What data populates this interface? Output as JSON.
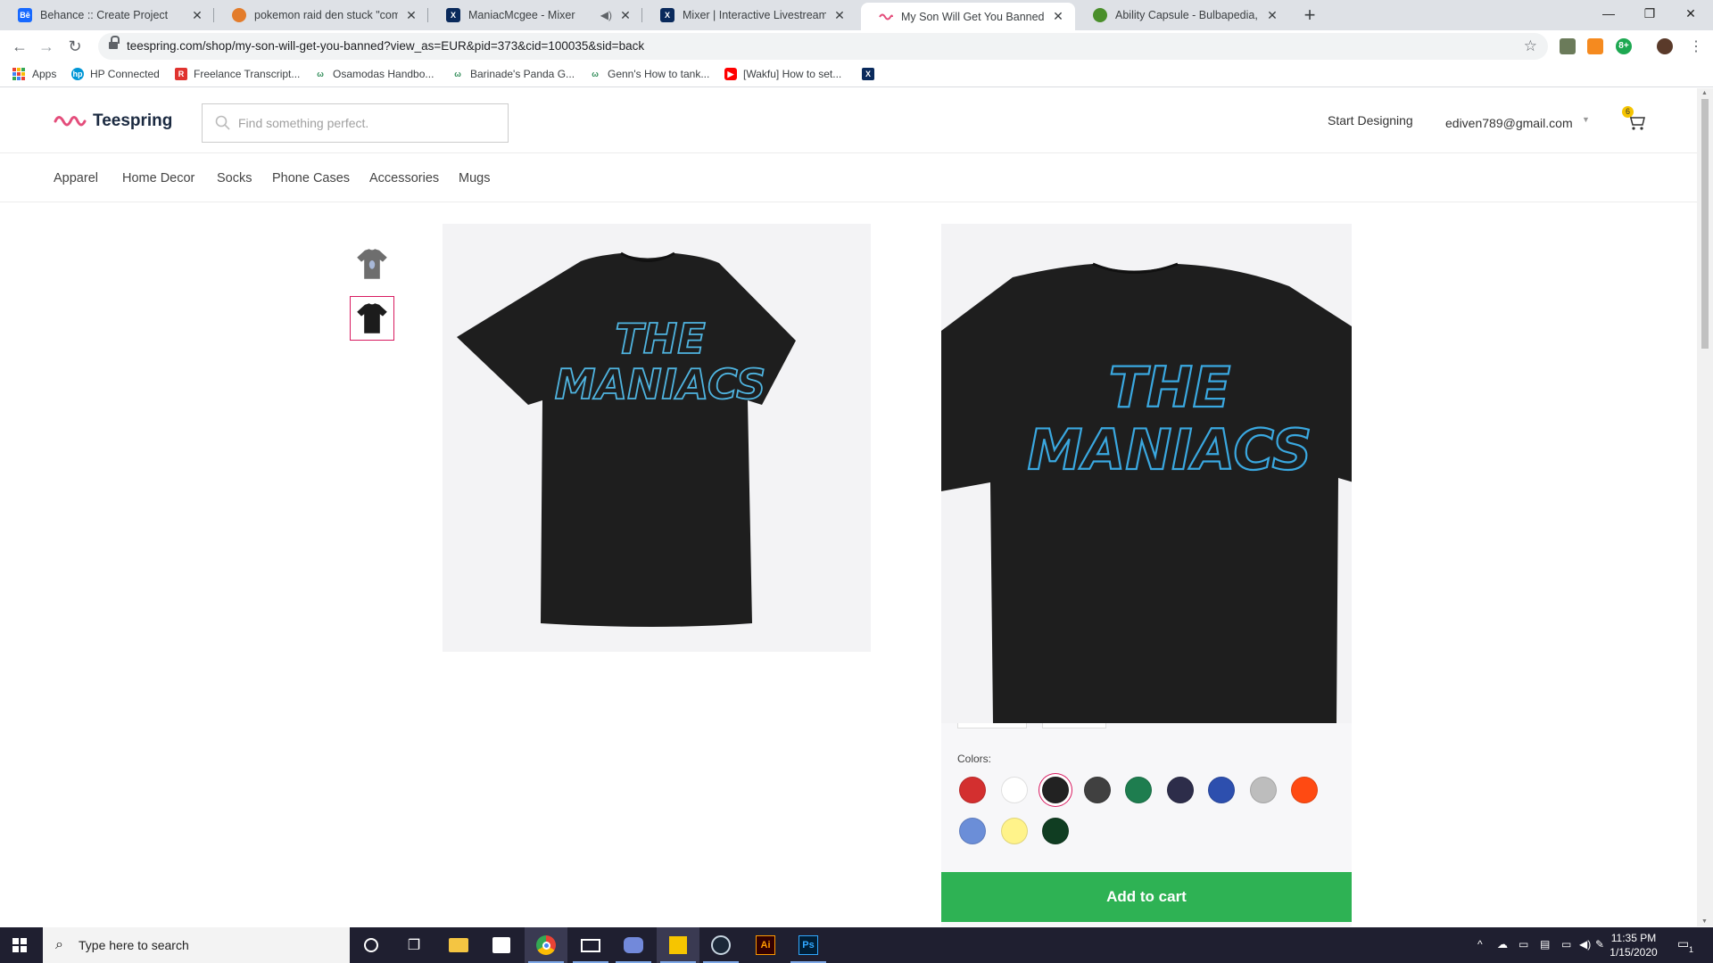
{
  "browser": {
    "tabs": [
      {
        "title": "Behance :: Create Project",
        "favicon": "Bē",
        "favicon_color": "#1769ff"
      },
      {
        "title": "pokemon raid den stuck \"commu",
        "favicon": "",
        "favicon_color": "#e37c2b"
      },
      {
        "title": "ManiacMcgee - Mixer",
        "favicon": "X",
        "favicon_color": "#0a2a5c"
      },
      {
        "title": "Mixer | Interactive Livestreaming",
        "favicon": "X",
        "favicon_color": "#0a2a5c"
      },
      {
        "title": "My Son Will Get You Banned Pro",
        "favicon": "",
        "favicon_color": "#e44d7b"
      },
      {
        "title": "Ability Capsule - Bulbapedia, the",
        "favicon": "",
        "favicon_color": "#4a8f2b"
      }
    ],
    "url": "teespring.com/shop/my-son-will-get-you-banned?view_as=EUR&pid=373&cid=100035&sid=back",
    "bookmarks": [
      {
        "label": "Apps"
      },
      {
        "label": "HP Connected"
      },
      {
        "label": "Freelance Transcript..."
      },
      {
        "label": "Osamodas Handbo..."
      },
      {
        "label": "Barinade's Panda G..."
      },
      {
        "label": "Genn's How to tank..."
      },
      {
        "label": "[Wakfu] How to set..."
      }
    ],
    "ext_badge": "8+"
  },
  "site": {
    "logo": "Teespring",
    "search_placeholder": "Find something perfect.",
    "start_designing": "Start Designing",
    "account_email": "ediven789@gmail.com",
    "cart_count": "6",
    "categories": [
      "Apparel",
      "Home Decor",
      "Socks",
      "Phone Cases",
      "Accessories",
      "Mugs"
    ]
  },
  "product": {
    "shirt_text_line1": "THE",
    "shirt_text_line2": "MANIACS",
    "colors_label": "Colors:",
    "colors": [
      {
        "name": "red",
        "hex": "#d32f2f"
      },
      {
        "name": "white",
        "hex": "#ffffff"
      },
      {
        "name": "black",
        "hex": "#222222",
        "selected": true
      },
      {
        "name": "dark-heather",
        "hex": "#404040"
      },
      {
        "name": "kelly-green",
        "hex": "#1e7d4f"
      },
      {
        "name": "navy",
        "hex": "#2d2d4a"
      },
      {
        "name": "royal-blue",
        "hex": "#2d4fae"
      },
      {
        "name": "light-grey",
        "hex": "#bdbdbd"
      },
      {
        "name": "orange",
        "hex": "#ff4a12"
      },
      {
        "name": "carolina-blue",
        "hex": "#6b8ed8"
      },
      {
        "name": "yellow",
        "hex": "#fff38a"
      },
      {
        "name": "forest-green",
        "hex": "#103d22"
      }
    ],
    "add_to_cart": "Add to cart"
  },
  "taskbar": {
    "search_text": "Type here to search",
    "time": "11:35 PM",
    "date": "1/15/2020",
    "notifications": "1"
  }
}
